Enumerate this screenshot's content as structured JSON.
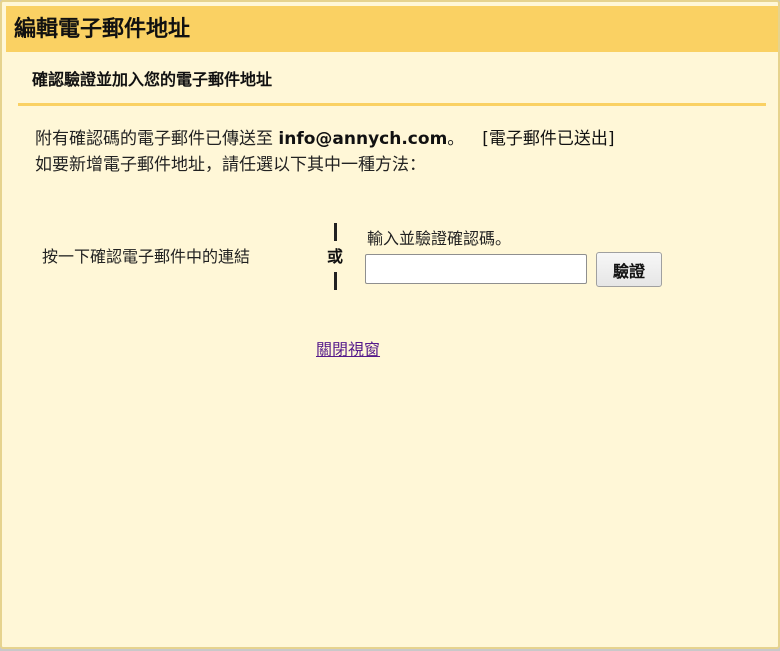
{
  "window": {
    "title": "編輯電子郵件地址"
  },
  "section": {
    "heading": "確認驗證並加入您的電子郵件地址"
  },
  "message": {
    "sent_prefix": "附有確認碼的電子郵件已傳送至 ",
    "email": "info@annych.com",
    "sent_suffix": "。",
    "sent_status": "[電子郵件已送出]",
    "instruction": "如要新增電子郵件地址，請任選以下其中一種方法："
  },
  "options": {
    "left_label": "按一下確認電子郵件中的連結",
    "or_label": "或",
    "right_label": "輸入並驗證確認碼。",
    "code_value": "",
    "verify_label": "驗證"
  },
  "footer": {
    "close_link": "關閉視窗"
  },
  "colors": {
    "title_bar": "#fad163",
    "background": "#fff7d7",
    "link": "#551a8b"
  }
}
